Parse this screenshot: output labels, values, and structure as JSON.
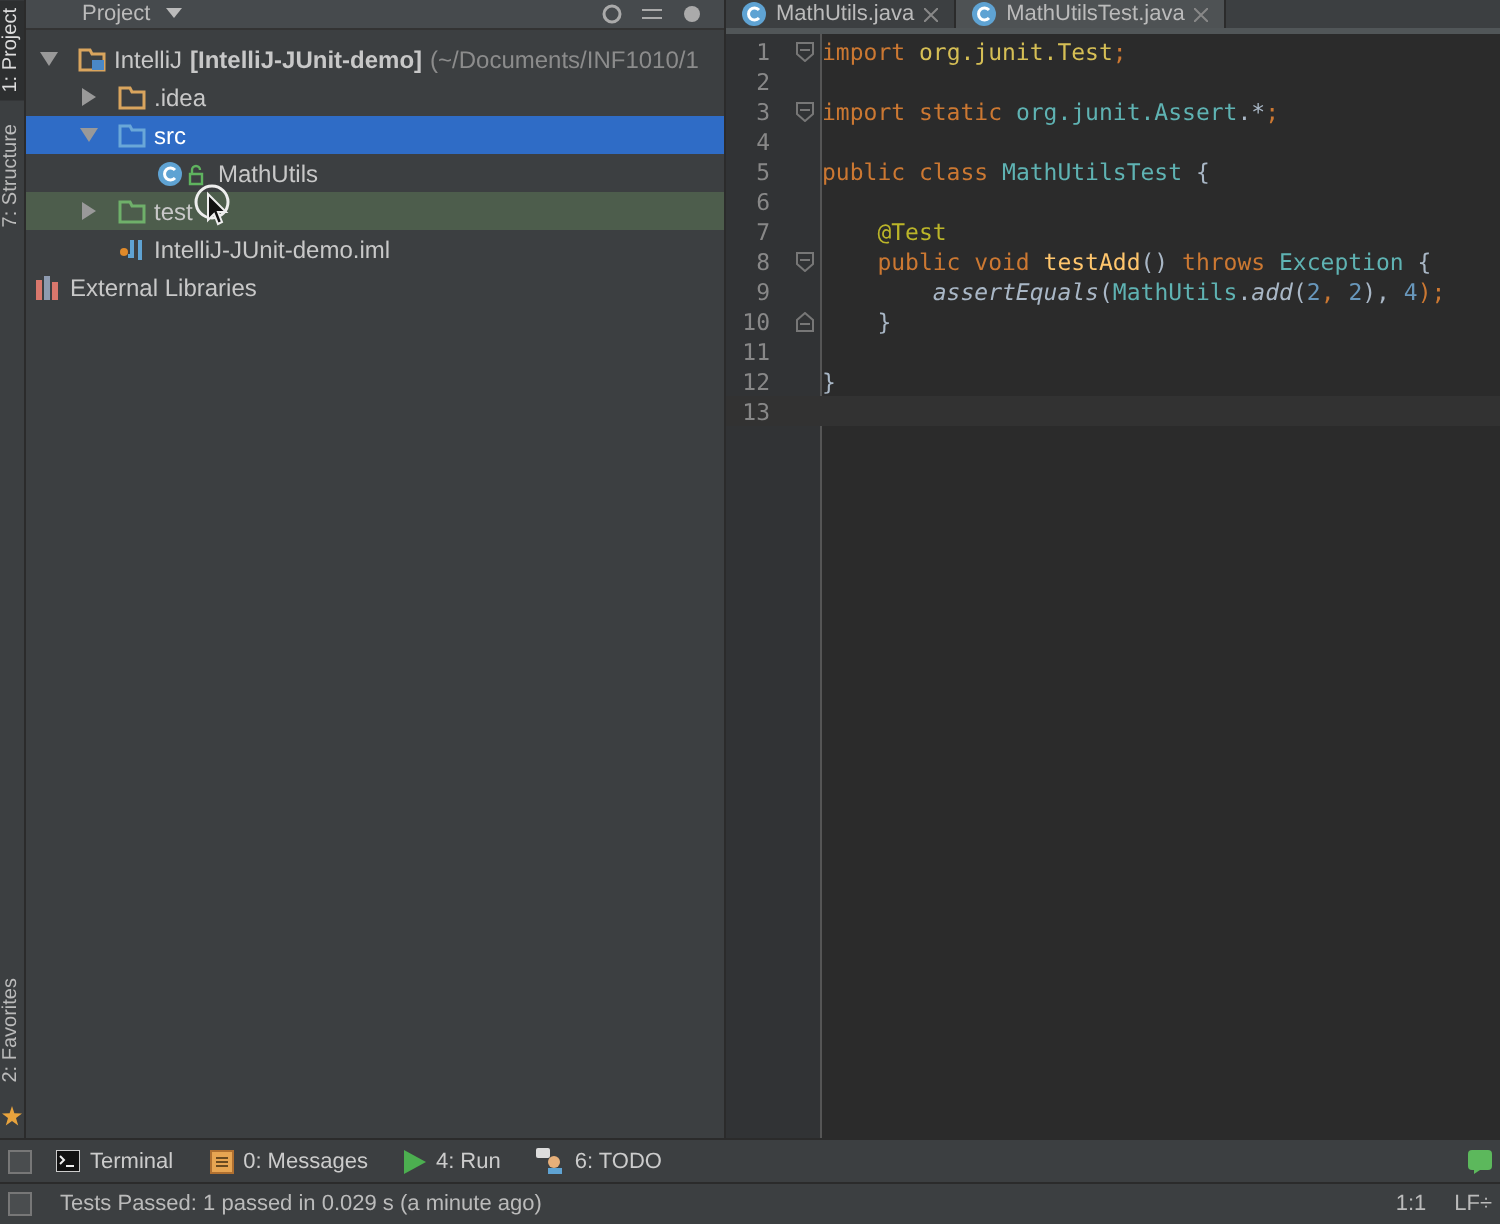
{
  "side_tabs": [
    {
      "label": "1: Project",
      "selected": true
    },
    {
      "label": "7: Structure",
      "selected": false
    }
  ],
  "side_tabs_bottom": [
    {
      "label": "2: Favorites",
      "selected": false
    }
  ],
  "project_panel": {
    "title": "Project",
    "tree": [
      {
        "kind": "module",
        "name": "IntelliJ",
        "module": "[IntelliJ-JUnit-demo]",
        "path": "(~/Documents/INF1010/1",
        "expanded": true,
        "selected": false,
        "hovered": false,
        "children": [
          {
            "kind": "folder",
            "name": ".idea",
            "expanded": false,
            "selected": false,
            "hovered": false
          },
          {
            "kind": "source",
            "name": "src",
            "expanded": true,
            "selected": true,
            "hovered": false,
            "children": [
              {
                "kind": "class",
                "name": "MathUtils",
                "selected": false,
                "hovered": false
              }
            ]
          },
          {
            "kind": "test",
            "name": "test",
            "expanded": false,
            "selected": false,
            "hovered": true
          },
          {
            "kind": "iml",
            "name": "IntelliJ-JUnit-demo.iml",
            "selected": false,
            "hovered": false
          }
        ]
      },
      {
        "kind": "libraries",
        "name": "External Libraries",
        "selected": false,
        "hovered": false
      }
    ]
  },
  "editor_tabs": [
    {
      "label": "MathUtils.java",
      "selected": false
    },
    {
      "label": "MathUtilsTest.java",
      "selected": true
    }
  ],
  "code": [
    {
      "number": "1",
      "kind": "fold_start",
      "tokens": [
        {
          "t": "import ",
          "kind": "kw"
        },
        {
          "t": "org.junit.Test",
          "kind": "pkg"
        },
        {
          "t": ";",
          "kind": "kw"
        }
      ]
    },
    {
      "number": "2",
      "kind": "plain"
    },
    {
      "number": "3",
      "kind": "fold_start",
      "tokens": [
        {
          "t": "import static ",
          "kind": "kw"
        },
        {
          "t": "org.junit.Assert",
          "kind": "cls"
        },
        {
          "t": ".*",
          "kind": "plain"
        },
        {
          "t": ";",
          "kind": "kw"
        }
      ]
    },
    {
      "number": "4",
      "kind": "plain"
    },
    {
      "number": "5",
      "kind": "plain",
      "tokens": [
        {
          "t": "public class ",
          "kind": "kw"
        },
        {
          "t": "MathUtilsTest ",
          "kind": "cls"
        },
        {
          "t": "{",
          "kind": "plain"
        }
      ]
    },
    {
      "number": "6",
      "kind": "plain"
    },
    {
      "number": "7",
      "kind": "plain",
      "tokens": [
        {
          "t": "    @Test",
          "kind": "ann"
        }
      ]
    },
    {
      "number": "8",
      "kind": "fold_start",
      "tokens": [
        {
          "t": "    public void ",
          "kind": "kw"
        },
        {
          "t": "testAdd",
          "kind": "fn"
        },
        {
          "t": "() ",
          "kind": "plain"
        },
        {
          "t": "throws ",
          "kind": "kw"
        },
        {
          "t": "Exception ",
          "kind": "cls"
        },
        {
          "t": "{",
          "kind": "plain"
        }
      ]
    },
    {
      "number": "9",
      "kind": "plain",
      "tokens": [
        {
          "t": "        assertEquals",
          "kind": "static"
        },
        {
          "t": "(",
          "kind": "plain"
        },
        {
          "t": "MathUtils",
          "kind": "cls"
        },
        {
          "t": ".",
          "kind": "plain"
        },
        {
          "t": "add",
          "kind": "static"
        },
        {
          "t": "(",
          "kind": "plain"
        },
        {
          "t": "2",
          "kind": "num"
        },
        {
          "t": ", ",
          "kind": "kw"
        },
        {
          "t": "2",
          "kind": "num"
        },
        {
          "t": "), ",
          "kind": "plain"
        },
        {
          "t": "4",
          "kind": "num"
        },
        {
          "t": ");",
          "kind": "kw"
        }
      ]
    },
    {
      "number": "10",
      "kind": "fold_end",
      "tokens": [
        {
          "t": "    }",
          "kind": "plain"
        }
      ]
    },
    {
      "number": "11",
      "kind": "plain"
    },
    {
      "number": "12",
      "kind": "plain",
      "tokens": [
        {
          "t": "}",
          "kind": "plain"
        }
      ]
    },
    {
      "number": "13",
      "kind": "plain",
      "current": true
    }
  ],
  "tool_windows": [
    {
      "kind": "terminal",
      "label": "Terminal"
    },
    {
      "kind": "messages",
      "label": "0: Messages"
    },
    {
      "kind": "run",
      "label": "4: Run"
    },
    {
      "kind": "todo",
      "label": "6: TODO"
    }
  ],
  "status_bar": {
    "message": "Tests Passed: 1 passed in 0.029 s (a minute ago)",
    "position": "1:1",
    "line_separator": "LF÷"
  }
}
